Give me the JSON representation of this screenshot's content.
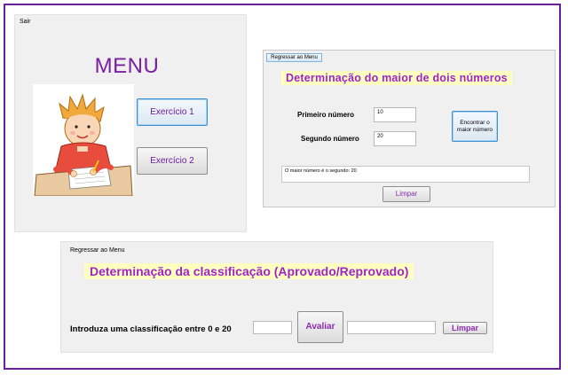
{
  "menu_window": {
    "exit_label": "Sair",
    "title": "MENU",
    "illustration_icon": "boy-writing-illustration",
    "buttons": [
      "Exercício 1",
      "Exercício 2"
    ]
  },
  "exercise1_window": {
    "back_label": "Regressar ao Menu",
    "title": "Determinação do maior de dois números",
    "first_label": "Primeiro número",
    "first_value": "10",
    "second_label": "Segundo número",
    "second_value": "20",
    "find_button": "Encontrar o maior número",
    "result_text": "O maior número é o segundo: 20",
    "clear_button": "Limpar"
  },
  "exercise2_window": {
    "back_label": "Regressar ao Menu",
    "title": "Determinação da classificação (Aprovado/Reprovado)",
    "prompt_label": "Introduza uma classificação entre 0 e 20",
    "grade_value": "",
    "evaluate_button": "Avaliar",
    "result_value": "",
    "clear_button": "Limpar"
  },
  "colors": {
    "frame_border": "#6a1e9a",
    "title_purple": "#7b1fa2",
    "highlight_bg": "#ffffc0",
    "highlight_text": "#a024c8"
  }
}
